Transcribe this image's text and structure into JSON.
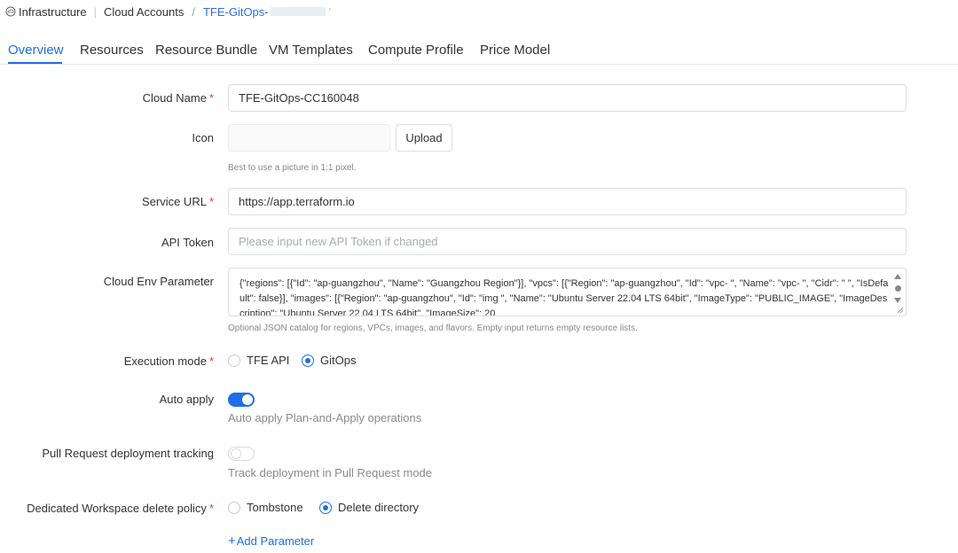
{
  "breadcrumb": {
    "root": "Infrastructure",
    "section": "Cloud Accounts",
    "current": "TFE-GitOps-",
    "trailing": "'"
  },
  "tabs": [
    {
      "label": "Overview",
      "active": true
    },
    {
      "label": "Resources",
      "active": false
    },
    {
      "label": "Resource Bundle",
      "active": false
    },
    {
      "label": "VM Templates",
      "active": false
    },
    {
      "label": "Compute Profile",
      "active": false
    },
    {
      "label": "Price Model",
      "active": false
    }
  ],
  "form": {
    "cloud_name": {
      "label": "Cloud Name",
      "value": "TFE-GitOps-CC160048"
    },
    "icon": {
      "label": "Icon",
      "upload_label": "Upload",
      "hint": "Best to use a picture in 1:1 pixel."
    },
    "service_url": {
      "label": "Service URL",
      "value": "https://app.terraform.io"
    },
    "api_token": {
      "label": "API Token",
      "value": "",
      "placeholder": "Please input new API Token if changed"
    },
    "cloud_env": {
      "label": "Cloud Env Parameter",
      "value": "{\"regions\": [{\"Id\": \"ap-guangzhou\", \"Name\": \"Guangzhou Region\"}], \"vpcs\": [{\"Region\": \"ap-guangzhou\", \"Id\": \"vpc-        \", \"Name\": \"vpc-       \", \"Cidr\": \"           \", \"IsDefault\": false}], \"images\": [{\"Region\": \"ap-guangzhou\", \"Id\": \"img       \", \"Name\": \"Ubuntu Server 22.04 LTS 64bit\", \"ImageType\": \"PUBLIC_IMAGE\", \"ImageDescription\": \"Ubuntu Server 22.04 LTS 64bit\", \"ImageSize\": 20",
      "hint": "Optional JSON catalog for regions, VPCs, images, and flavors. Empty input returns empty resource lists."
    },
    "execution_mode": {
      "label": "Execution mode",
      "options": [
        {
          "label": "TFE API",
          "selected": false
        },
        {
          "label": "GitOps",
          "selected": true
        }
      ]
    },
    "auto_apply": {
      "label": "Auto apply",
      "enabled": true,
      "hint": "Auto apply Plan-and-Apply operations"
    },
    "pr_tracking": {
      "label": "Pull Request deployment tracking",
      "enabled": false,
      "hint": "Track deployment in Pull Request mode"
    },
    "delete_policy": {
      "label": "Dedicated Workspace delete policy",
      "options": [
        {
          "label": "Tombstone",
          "selected": false
        },
        {
          "label": "Delete directory",
          "selected": true
        }
      ]
    },
    "add_parameter_label": "Add Parameter"
  },
  "colors": {
    "accent": "#1f6ee5",
    "required": "#e23b3b"
  }
}
